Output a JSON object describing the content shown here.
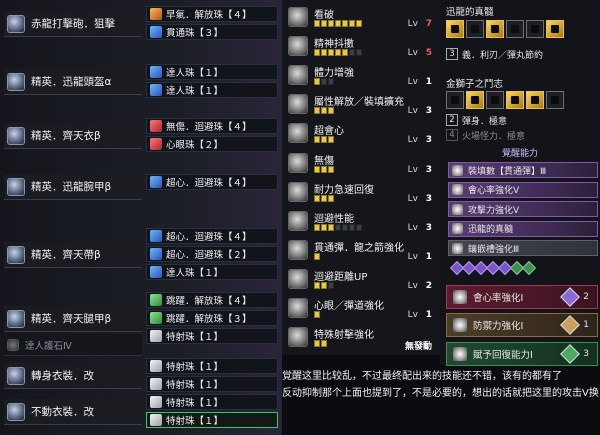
{
  "equipment": [
    {
      "name": "赤龍打擊砲．狙擊",
      "decos": [
        {
          "label": "早氣．解放珠【４】",
          "gem": "orange"
        },
        {
          "label": "貫通珠【３】",
          "gem": "blue"
        }
      ]
    },
    {
      "name": "精英．迅龍頭盔α",
      "decos": [
        {
          "label": "達人珠【１】",
          "gem": "blue"
        },
        {
          "label": "達人珠【１】",
          "gem": "blue"
        }
      ]
    },
    {
      "name": "精英．齊天衣β",
      "decos": [
        {
          "label": "無傷．迴避珠【４】",
          "gem": "red"
        },
        {
          "label": "心眼珠【２】",
          "gem": "red"
        }
      ]
    },
    {
      "name": "精英．迅龍腕甲β",
      "decos": [
        {
          "label": "超心．迴避珠【４】",
          "gem": "blue"
        }
      ]
    },
    {
      "name": "精英．齊天帶β",
      "decos": [
        {
          "label": "超心．迴避珠【４】",
          "gem": "blue"
        },
        {
          "label": "超心．迴避珠【２】",
          "gem": "blue"
        },
        {
          "label": "達人珠【１】",
          "gem": "blue"
        }
      ]
    },
    {
      "name": "精英．齊天腿甲β",
      "decos": [
        {
          "label": "跳躍．解放珠【４】",
          "gem": "green"
        },
        {
          "label": "跳躍．解放珠【３】",
          "gem": "green"
        },
        {
          "label": "特射珠【１】",
          "gem": "white"
        }
      ]
    }
  ],
  "charm": {
    "name": "達人護石Ⅳ"
  },
  "mantles": [
    {
      "name": "轉身衣裝．改",
      "decos": [
        {
          "label": "特射珠【１】",
          "gem": "white"
        },
        {
          "label": "特射珠【１】",
          "gem": "white"
        }
      ]
    },
    {
      "name": "不動衣裝．改",
      "decos": [
        {
          "label": "特射珠【１】",
          "gem": "white"
        },
        {
          "label": "特射珠【１】",
          "gem": "white",
          "active": true
        }
      ]
    }
  ],
  "skills": [
    {
      "name": "看破",
      "lv": "Lv",
      "value": "7",
      "on": 7,
      "max": 7,
      "color": "#e85a5a"
    },
    {
      "name": "精神抖擻",
      "lv": "Lv",
      "value": "5",
      "on": 5,
      "max": 7,
      "color": "#e85a5a"
    },
    {
      "name": "體力增強",
      "lv": "Lv",
      "value": "1",
      "on": 1,
      "max": 3,
      "color": "#ffffff"
    },
    {
      "name": "屬性解放／裝填擴充",
      "lv": "Lv",
      "value": "3",
      "on": 3,
      "max": 3,
      "color": "#ffffff"
    },
    {
      "name": "超會心",
      "lv": "Lv",
      "value": "3",
      "on": 3,
      "max": 3,
      "color": "#ffffff"
    },
    {
      "name": "無傷",
      "lv": "Lv",
      "value": "3",
      "on": 3,
      "max": 3,
      "color": "#ffffff"
    },
    {
      "name": "耐力急速回復",
      "lv": "Lv",
      "value": "3",
      "on": 3,
      "max": 3,
      "color": "#ffffff"
    },
    {
      "name": "迴避性能",
      "lv": "Lv",
      "value": "3",
      "on": 3,
      "max": 7,
      "color": "#ffffff"
    },
    {
      "name": "貫通彈．龍之箭強化",
      "lv": "Lv",
      "value": "1",
      "on": 1,
      "max": 1,
      "color": "#ffffff"
    },
    {
      "name": "迴避距離UP",
      "lv": "Lv",
      "value": "2",
      "on": 2,
      "max": 3,
      "color": "#ffffff"
    },
    {
      "name": "心眼／彈道強化",
      "lv": "Lv",
      "value": "1",
      "on": 1,
      "max": 1,
      "color": "#ffffff"
    },
    {
      "name": "特殊射擊強化",
      "lv": "",
      "value": "無發動",
      "on": 2,
      "max": 2,
      "color": "#ffffff"
    }
  ],
  "set1": {
    "title": "迅龍的真髓",
    "lines": [
      {
        "num": "3",
        "text": "義．利刃／彈丸節約"
      }
    ]
  },
  "set2": {
    "title": "金獅子之鬥志",
    "lines": [
      {
        "num": "2",
        "text": "彈身．極意"
      },
      {
        "num": "4",
        "text": "火場怪力．極意",
        "dim": true
      }
    ]
  },
  "awaken": {
    "title": "覺醒能力",
    "items": [
      {
        "label": "裝填數【貫通彈】Ⅲ"
      },
      {
        "label": "會心率強化Ⅴ"
      },
      {
        "label": "攻擊力強化Ⅴ"
      },
      {
        "label": "迅龍的真髓"
      },
      {
        "label": "鑲嵌槽強化Ⅲ",
        "gray": true
      }
    ]
  },
  "rampage": [
    {
      "label": "會心率強化Ⅰ",
      "level": "2",
      "style": "red",
      "gem": "#8c6ad6"
    },
    {
      "label": "防禦力強化Ⅰ",
      "level": "1",
      "style": "tan",
      "gem": "#c9a15a"
    },
    {
      "label": "賦予回復能力Ⅰ",
      "level": "3",
      "style": "grn",
      "gem": "#4caa62"
    }
  ],
  "comment": [
    "覚醒这里比较乱，不过最终配出来的技能还不错，该有的都有了",
    "反动抑制那个上面也提到了，不是必要的，想出的话就把这里的攻击V换了"
  ]
}
